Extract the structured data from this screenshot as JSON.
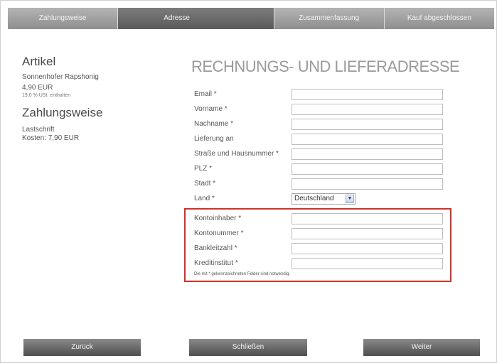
{
  "steps": [
    "Zahlungsweise",
    "Adresse",
    "Zusammenfassung",
    "Kauf abgeschlossen"
  ],
  "left": {
    "artikel_heading": "Artikel",
    "product_name": "Sonnenhofer Rapshonig",
    "price": "4,90 EUR",
    "vat_note": "19,0 % USt. enthalten",
    "payment_heading": "Zahlungsweise",
    "payment_method": "Lastschrift",
    "costs": "Kosten: 7,90 EUR"
  },
  "form": {
    "title": "RECHNUNGS- UND LIEFERADRESSE",
    "labels": {
      "email": "Email *",
      "vorname": "Vorname *",
      "nachname": "Nachname *",
      "lieferung": "Lieferung an",
      "strasse": "Straße und Hausnummer *",
      "plz": "PLZ *",
      "stadt": "Stadt *",
      "land": "Land *",
      "kontoinhaber": "Kontoinhaber *",
      "kontonummer": "Kontonummer *",
      "bankleitzahl": "Bankleitzahl *",
      "kreditinstitut": "Kreditinstitut *"
    },
    "values": {
      "email": "",
      "vorname": "",
      "nachname": "",
      "lieferung": "",
      "strasse": "",
      "plz": "",
      "stadt": "",
      "kontoinhaber": "",
      "kontonummer": "",
      "bankleitzahl": "",
      "kreditinstitut": ""
    },
    "land_selected": "Deutschland",
    "required_note": "Die mit * gekennzeichneten Felder sind notwendig."
  },
  "buttons": {
    "back": "Zurück",
    "close": "Schließen",
    "next": "Weiter"
  },
  "colors": {
    "highlight_border": "#d0312d"
  }
}
